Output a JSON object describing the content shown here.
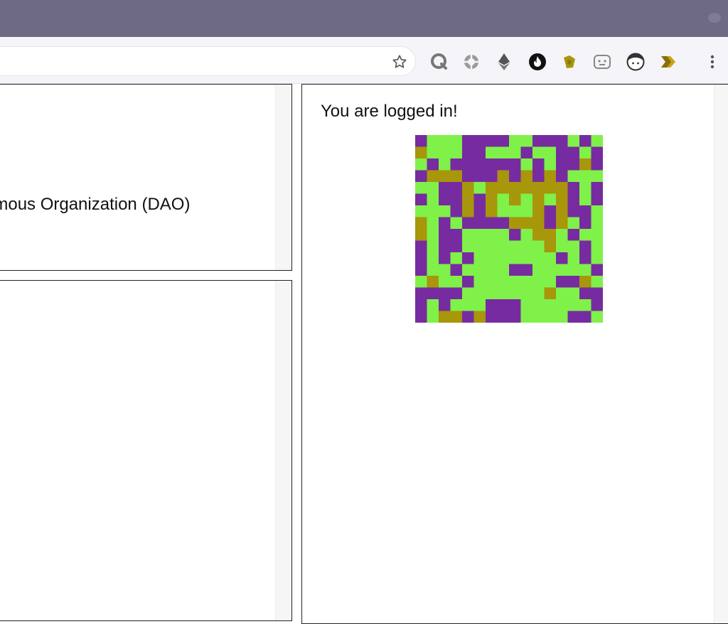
{
  "browser": {
    "extensions": [
      {
        "icon": "q-extension-icon"
      },
      {
        "icon": "crosshair-extension-icon"
      },
      {
        "icon": "ethereum-extension-icon"
      },
      {
        "icon": "flame-extension-icon"
      },
      {
        "icon": "puzzle-extension-icon"
      },
      {
        "icon": "robot-face-extension-icon"
      },
      {
        "icon": "face-extension-icon"
      },
      {
        "icon": "arrow-tag-extension-icon"
      }
    ],
    "bookmark_icon": "star-icon",
    "menu_icon": "kebab-menu-icon"
  },
  "content": {
    "dao_text": "omous Organization (DAO)",
    "login_message": "You are logged in!"
  },
  "identicon": {
    "colors": {
      "background": "#7ff149",
      "primary": "#772ba0",
      "accent": "#a8960b"
    },
    "grid": [
      "1000111100111010",
      "2000110001001101",
      "0101111110101121",
      "1222111212121000",
      "0011202222222101",
      "1011212020202101",
      "0001212000212110",
      "2010111122212010",
      "2011000010220100",
      "1011000000020010",
      "1010100000001010",
      "1001000011000001",
      "0200100000001120",
      "1111000000020011",
      "1010001110000001",
      "1022121110000110"
    ]
  }
}
